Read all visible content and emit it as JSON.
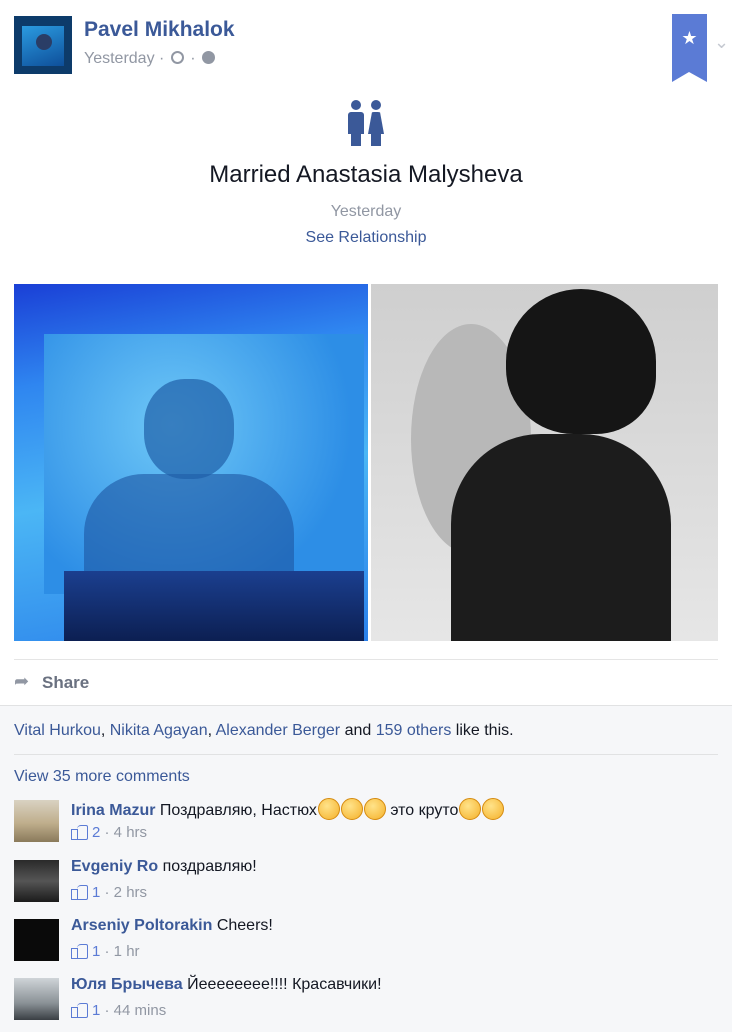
{
  "post": {
    "author": "Pavel Mikhalok",
    "timestamp": "Yesterday",
    "meta_separator": "·",
    "icons": {
      "time": "clock-icon",
      "audience": "globe-icon",
      "bookmark": "star-icon",
      "menu": "chevron-down-icon"
    }
  },
  "life_event": {
    "icon": "married-couple-icon",
    "title": "Married Anastasia Malysheva",
    "date": "Yesterday",
    "link": "See Relationship"
  },
  "photos": [
    {
      "description_name": "concert-photo"
    },
    {
      "description_name": "woman-portrait-photo"
    }
  ],
  "actions": {
    "share_label": "Share",
    "share_icon": "share-arrow-icon"
  },
  "likes": {
    "names": [
      "Vital Hurkou",
      "Nikita Agayan",
      "Alexander Berger"
    ],
    "sep1": ", ",
    "sep2": ", ",
    "and": " and ",
    "others": "159 others",
    "suffix": " like this."
  },
  "comments_link": "View 35 more comments",
  "comments": [
    {
      "name": "Irina Mazur",
      "text": "Поздравляю, Настюх",
      "text2": " это круто",
      "likes": "2",
      "time": "· 4 hrs"
    },
    {
      "name": "Evgeniy Ro",
      "text": "поздравляю!",
      "likes": "1",
      "time": "· 2 hrs"
    },
    {
      "name": "Arseniy Poltorakin",
      "text": "Cheers!",
      "likes": "1",
      "time": "· 1 hr"
    },
    {
      "name": "Юля Брычева",
      "text": "Йееееееее!!!! Красавчики!",
      "likes": "1",
      "time": "· 44 mins"
    }
  ],
  "colors": {
    "link": "#3b5998",
    "muted": "#9197a3",
    "bookmark": "#5b7bd5"
  }
}
